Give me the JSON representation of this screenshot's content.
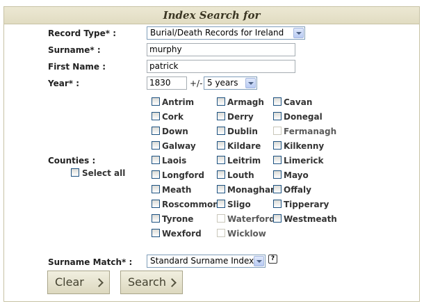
{
  "header": {
    "title": "Index Search for"
  },
  "form": {
    "record_type_label": "Record Type* :",
    "record_type_value": "Burial/Death Records for Ireland",
    "surname_label": "Surname* :",
    "surname_value": "murphy",
    "first_name_label": "First Name :",
    "first_name_value": "patrick",
    "year_label": "Year* :",
    "year_value": "1830",
    "plus_minus": "+/-",
    "range_value": "5 years",
    "counties_label": "Counties :",
    "select_all_label": "Select all",
    "surname_match_label": "Surname Match* :",
    "surname_match_value": "Standard Surname Index",
    "help_icon_text": "?"
  },
  "counties": {
    "col1": [
      {
        "name": "Antrim",
        "disabled": false
      },
      {
        "name": "Cork",
        "disabled": false
      },
      {
        "name": "Down",
        "disabled": false
      },
      {
        "name": "Galway",
        "disabled": false
      },
      {
        "name": "Laois",
        "disabled": false
      },
      {
        "name": "Longford",
        "disabled": false
      },
      {
        "name": "Meath",
        "disabled": false
      },
      {
        "name": "Roscommon",
        "disabled": false
      },
      {
        "name": "Tyrone",
        "disabled": false
      },
      {
        "name": "Wexford",
        "disabled": false
      }
    ],
    "col2": [
      {
        "name": "Armagh",
        "disabled": false
      },
      {
        "name": "Derry",
        "disabled": false
      },
      {
        "name": "Dublin",
        "disabled": false
      },
      {
        "name": "Kildare",
        "disabled": false
      },
      {
        "name": "Leitrim",
        "disabled": false
      },
      {
        "name": "Louth",
        "disabled": false
      },
      {
        "name": "Monaghan",
        "disabled": false
      },
      {
        "name": "Sligo",
        "disabled": false
      },
      {
        "name": "Waterford",
        "disabled": true
      },
      {
        "name": "Wicklow",
        "disabled": true
      }
    ],
    "col3": [
      {
        "name": "Cavan",
        "disabled": false
      },
      {
        "name": "Donegal",
        "disabled": false
      },
      {
        "name": "Fermanagh",
        "disabled": true
      },
      {
        "name": "Kilkenny",
        "disabled": false
      },
      {
        "name": "Limerick",
        "disabled": false
      },
      {
        "name": "Mayo",
        "disabled": false
      },
      {
        "name": "Offaly",
        "disabled": false
      },
      {
        "name": "Tipperary",
        "disabled": false
      },
      {
        "name": "Westmeath",
        "disabled": false
      }
    ]
  },
  "buttons": {
    "clear_label": "Clear",
    "search_label": "Search"
  },
  "colors": {
    "header_bg": "#e1dcc2",
    "border": "#c7c2a4",
    "button_bg": "#dcd8bf"
  }
}
